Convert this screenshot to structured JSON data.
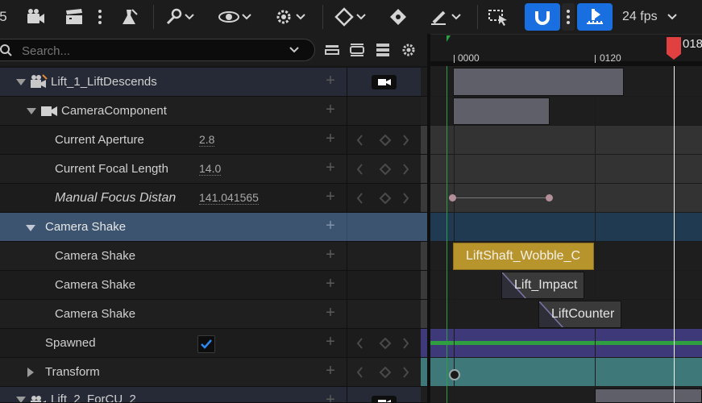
{
  "toolbar": {
    "left_fragment": "5",
    "fps_label": "24 fps",
    "icons": [
      "camera-icon",
      "clapperboard-icon",
      "more-icon",
      "flask-icon",
      "wrench-icon",
      "eye-icon",
      "gear-icon",
      "diamond-icon",
      "key-diamond-icon",
      "paint-brush-icon",
      "select-cursor-icon",
      "magnet-icon",
      "more-icon",
      "snap-playhead-icon"
    ],
    "accent": "#1a6fe0"
  },
  "search": {
    "placeholder": "Search..."
  },
  "outliner": {
    "rows": [
      {
        "label": "Lift_1_LiftDescends"
      },
      {
        "label": "CameraComponent"
      },
      {
        "label": "Current Aperture",
        "value": "2.8"
      },
      {
        "label": "Current Focal Length",
        "value": "14.0"
      },
      {
        "label": "Manual Focus Distan",
        "value": "141.041565"
      },
      {
        "label": "Camera Shake"
      },
      {
        "label": "Camera Shake"
      },
      {
        "label": "Camera Shake"
      },
      {
        "label": "Camera Shake"
      },
      {
        "label": "Spawned"
      },
      {
        "label": "Transform"
      },
      {
        "label": "Lift_2_ForCU_2"
      }
    ]
  },
  "timeline": {
    "ticks": [
      "0000",
      "0120"
    ],
    "playhead_label": "018",
    "sections": [
      "LiftShaft_Wobble_C",
      "Lift_Impact",
      "LiftCounter"
    ],
    "colors": {
      "selected_row": "#3c5470",
      "shake_section": "#b8952c",
      "spawned_bar": "#3e3a7a",
      "spawned_line": "#2e9e40",
      "transform_row": "#3f7878",
      "playhead": "#e04040"
    }
  }
}
